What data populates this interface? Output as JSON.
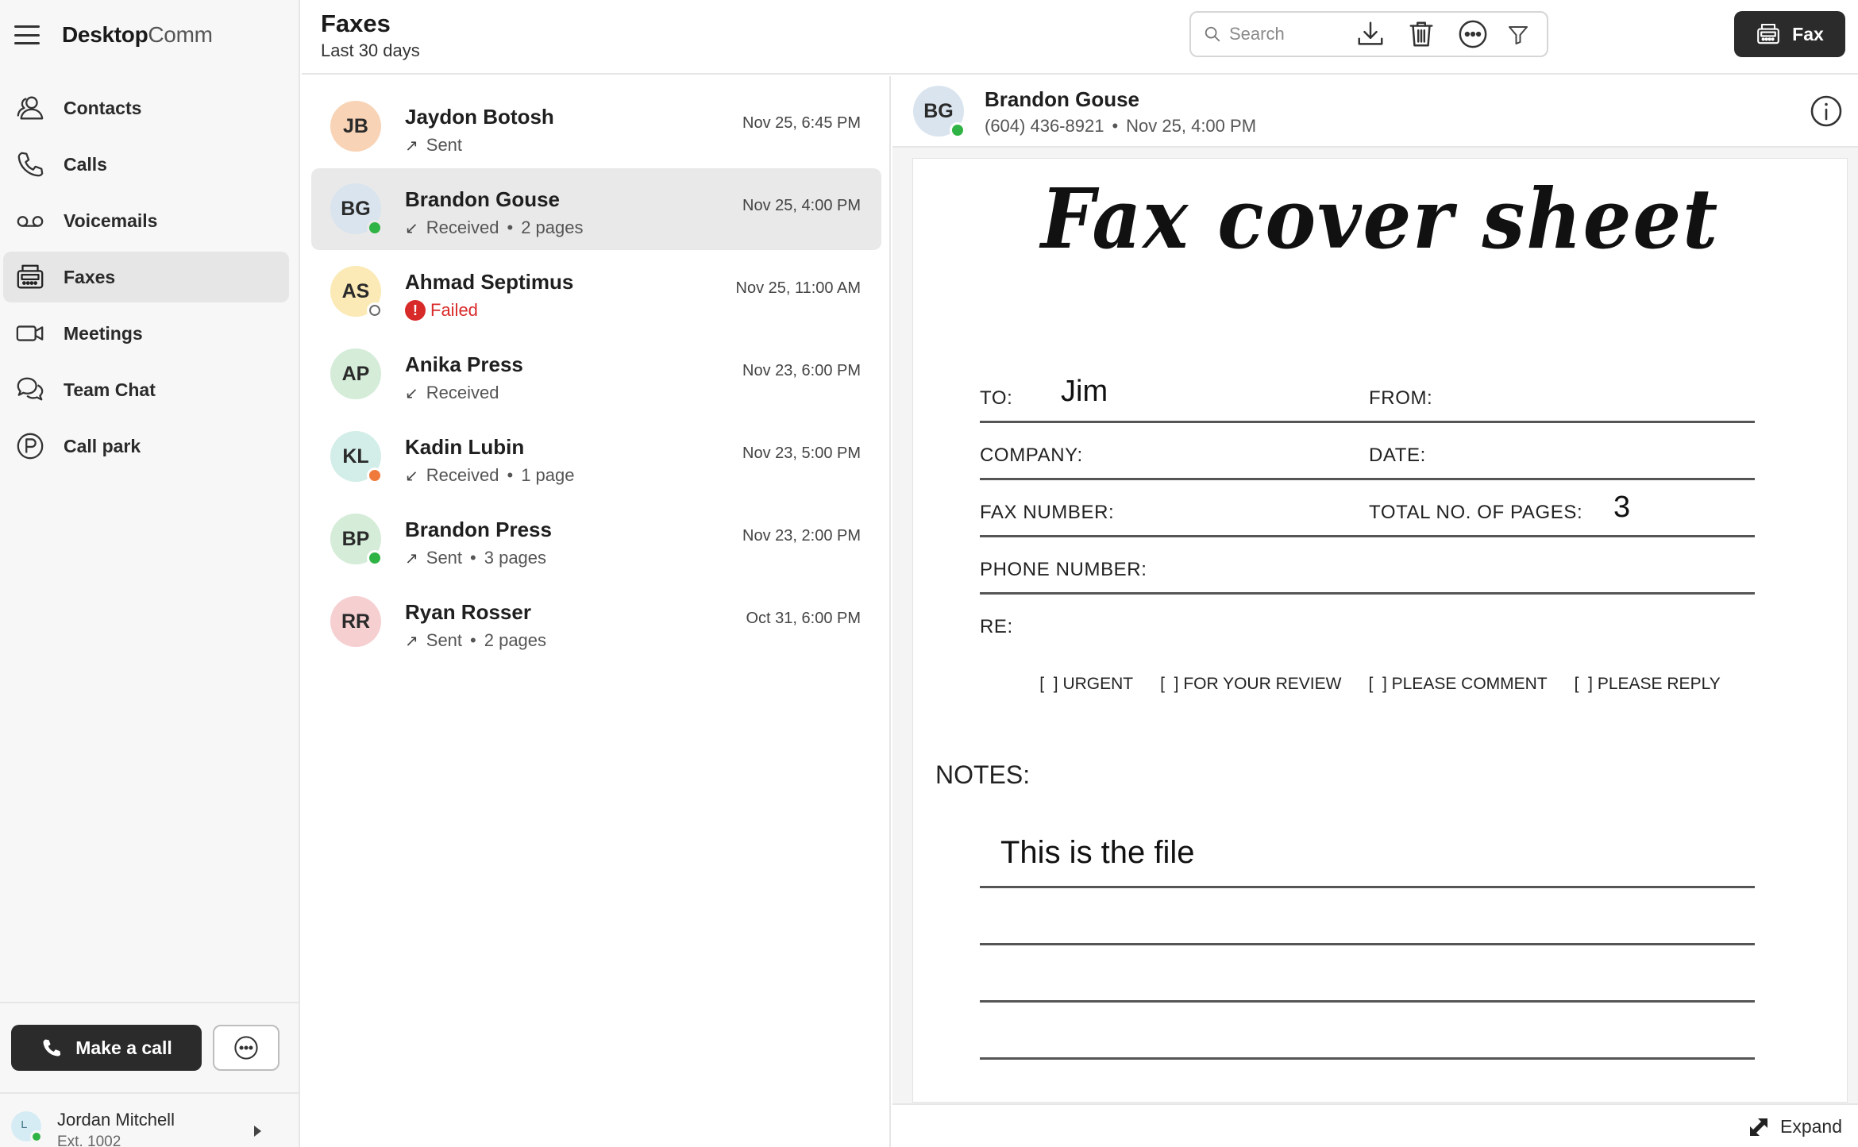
{
  "app": {
    "brand_bold": "Desktop",
    "brand_light": "Comm"
  },
  "nav": {
    "items": [
      {
        "label": "Contacts",
        "icon": "contacts-icon"
      },
      {
        "label": "Calls",
        "icon": "phone-icon"
      },
      {
        "label": "Voicemails",
        "icon": "voicemail-icon"
      },
      {
        "label": "Faxes",
        "icon": "fax-icon",
        "active": true
      },
      {
        "label": "Meetings",
        "icon": "video-icon"
      },
      {
        "label": "Team Chat",
        "icon": "chat-icon"
      },
      {
        "label": "Call park",
        "icon": "park-icon"
      }
    ]
  },
  "sidebar_bottom": {
    "make_call_label": "Make a call",
    "user": {
      "name": "Jordan Mitchell",
      "ext": "Ext. 1002"
    }
  },
  "header": {
    "title": "Faxes",
    "subtitle": "Last 30 days",
    "search_placeholder": "Search",
    "fax_button_label": "Fax"
  },
  "faxes": [
    {
      "initials": "JB",
      "name": "Jaydon Botosh",
      "direction": "sent",
      "status": "Sent",
      "pages": "",
      "time": "Nov 25, 6:45 PM",
      "avatar_color": "#f8d3b6",
      "presence": ""
    },
    {
      "initials": "BG",
      "name": "Brandon Gouse",
      "direction": "received",
      "status": "Received",
      "pages": "2 pages",
      "time": "Nov 25, 4:00 PM",
      "avatar_color": "#d9e4ee",
      "presence": "online",
      "selected": true
    },
    {
      "initials": "AS",
      "name": "Ahmad Septimus",
      "direction": "failed",
      "status": "Failed",
      "pages": "",
      "time": "Nov 25, 11:00 AM",
      "avatar_color": "#fbeab5",
      "presence": "offline"
    },
    {
      "initials": "AP",
      "name": "Anika Press",
      "direction": "received",
      "status": "Received",
      "pages": "",
      "time": "Nov 23, 6:00 PM",
      "avatar_color": "#d4ecd8",
      "presence": ""
    },
    {
      "initials": "KL",
      "name": "Kadin Lubin",
      "direction": "received",
      "status": "Received",
      "pages": "1 page",
      "time": "Nov 23, 5:00 PM",
      "avatar_color": "#d3eee8",
      "presence": "away"
    },
    {
      "initials": "BP",
      "name": "Brandon Press",
      "direction": "sent",
      "status": "Sent",
      "pages": "3 pages",
      "time": "Nov 23, 2:00 PM",
      "avatar_color": "#d4ecd8",
      "presence": "online"
    },
    {
      "initials": "RR",
      "name": "Ryan Rosser",
      "direction": "sent",
      "status": "Sent",
      "pages": "2 pages",
      "time": "Oct 31, 6:00 PM",
      "avatar_color": "#f6cfd1",
      "presence": ""
    }
  ],
  "preview": {
    "initials": "BG",
    "name": "Brandon Gouse",
    "phone": "(604) 436-8921",
    "time": "Nov 25, 4:00 PM",
    "expand_label": "Expand",
    "document": {
      "title": "Fax cover sheet",
      "to_label": "TO:",
      "to_value": "Jim",
      "from_label": "FROM:",
      "company_label": "COMPANY:",
      "date_label": "DATE:",
      "fax_number_label": "FAX NUMBER:",
      "total_pages_label": "TOTAL NO. OF PAGES:",
      "total_pages_value": "3",
      "phone_number_label": "PHONE NUMBER:",
      "re_label": "RE:",
      "checks": [
        "[  ] URGENT",
        "[  ] FOR YOUR REVIEW",
        "[  ] PLEASE COMMENT",
        "[  ] PLEASE REPLY"
      ],
      "notes_label": "NOTES:",
      "notes_value": "This is the file"
    }
  }
}
